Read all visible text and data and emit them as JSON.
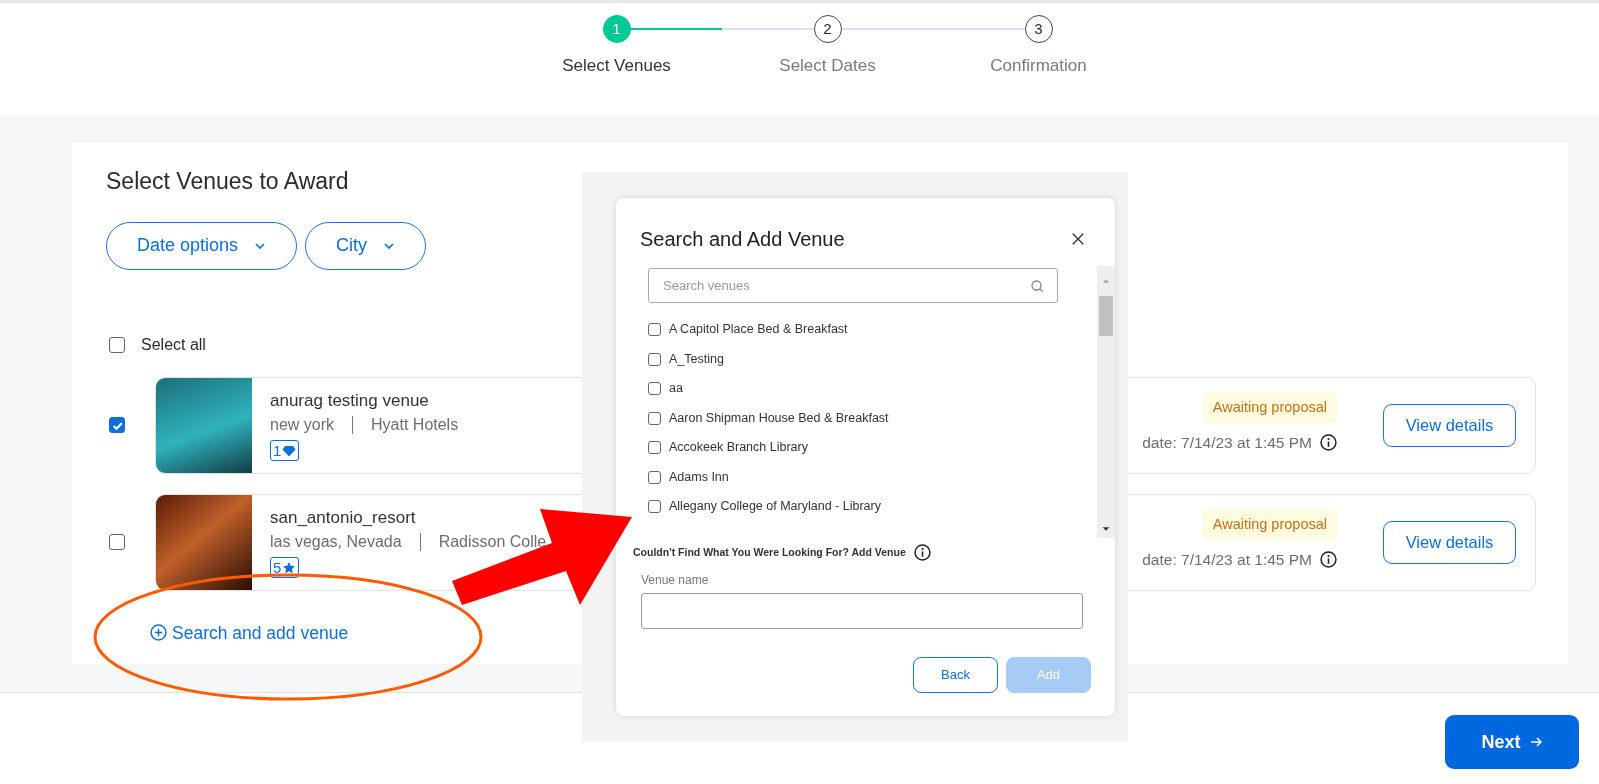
{
  "stepper": {
    "steps": [
      {
        "number": "1",
        "label": "Select Venues",
        "selected": true
      },
      {
        "number": "2",
        "label": "Select Dates",
        "selected": false
      },
      {
        "number": "3",
        "label": "Confirmation",
        "selected": false
      }
    ]
  },
  "award": {
    "title": "Select Venues to Award",
    "filters": [
      {
        "label": "Date options"
      },
      {
        "label": "City"
      }
    ],
    "select_all": {
      "label": "Select all",
      "checked": false
    },
    "venues": [
      {
        "name": "anurag testing venue",
        "location": "new york",
        "brand": "Hyatt Hotels",
        "rating": "1",
        "checked": true,
        "status": "Awaiting proposal",
        "updated": "date: 7/14/23 at 1:45 PM",
        "button": "View details"
      },
      {
        "name": "san_antonio_resort",
        "location": "las vegas, Nevada",
        "brand": "Radisson Colle",
        "rating": "5",
        "checked": false,
        "status": "Awaiting proposal",
        "updated": "date: 7/14/23 at 1:45 PM",
        "button": "View details"
      }
    ],
    "add_link": "Search and add venue"
  },
  "modal": {
    "title": "Search and Add Venue",
    "search": {
      "placeholder": "Search venues"
    },
    "venues": [
      {
        "name": "A Capitol Place Bed & Breakfast",
        "checked": false
      },
      {
        "name": "A_Testing",
        "checked": false
      },
      {
        "name": "aa",
        "checked": false
      },
      {
        "name": "Aaron Shipman House Bed & Breakfast",
        "checked": false
      },
      {
        "name": "Accokeek Branch Library",
        "checked": false
      },
      {
        "name": "Adams Inn",
        "checked": false
      },
      {
        "name": "Allegany College of Maryland - Library",
        "checked": false
      }
    ],
    "add_hint": "Couldn't Find What You Were Looking For? Add Venue",
    "venue_name": {
      "label": "Venue name"
    },
    "buttons": [
      {
        "label": "Back",
        "kind": "outline",
        "disabled": false
      },
      {
        "label": "Add",
        "kind": "primary",
        "disabled": true
      }
    ]
  },
  "footer": {
    "next": "Next"
  }
}
